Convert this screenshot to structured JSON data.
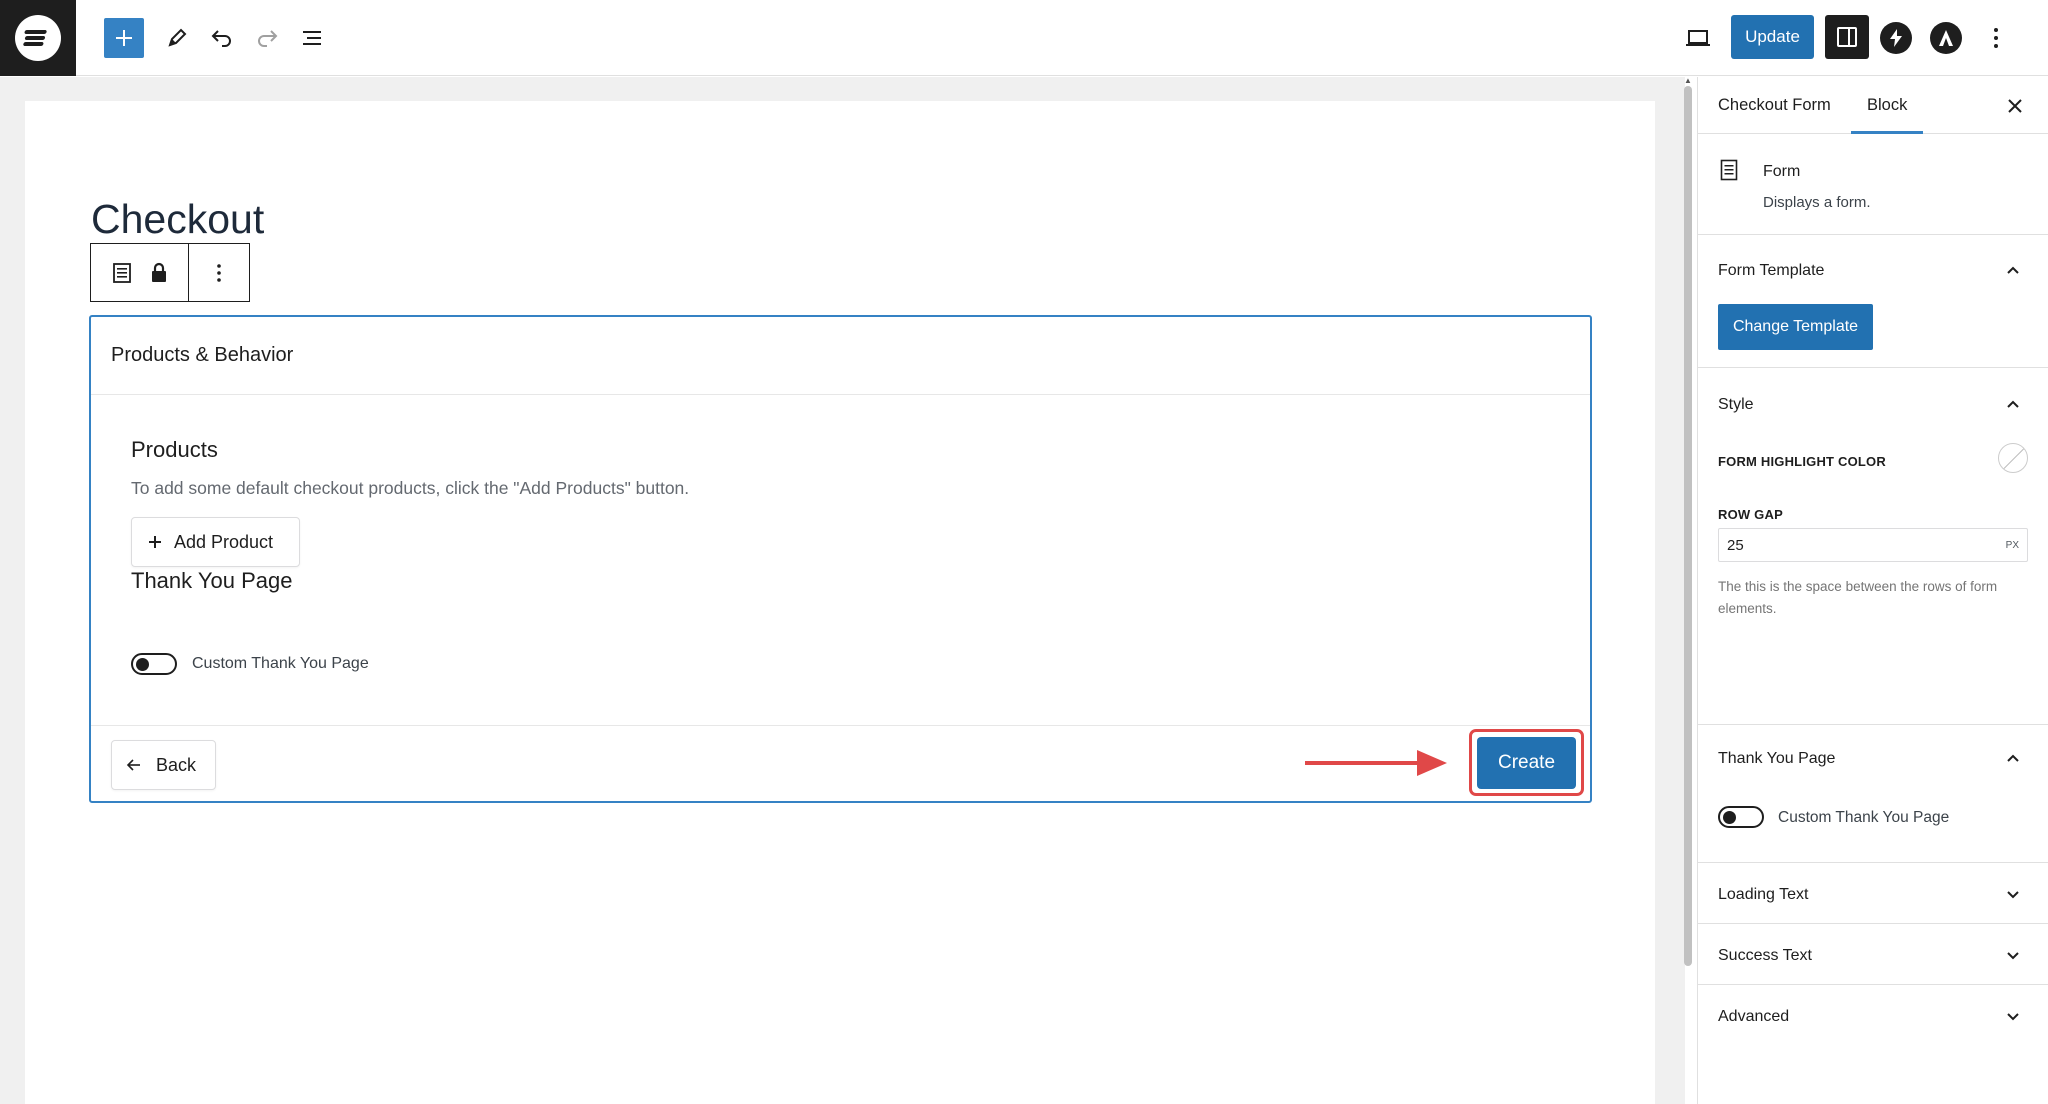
{
  "toolbar": {
    "add_icon": "plus-icon",
    "tools_icon": "pencil-icon",
    "undo_icon": "undo-icon",
    "redo_icon": "redo-icon",
    "outline_icon": "list-view-icon",
    "preview_icon": "desktop-icon",
    "update_label": "Update",
    "settings_icon": "sidebar-toggle-icon",
    "more_icon": "vertical-dots-icon"
  },
  "editor": {
    "page_title": "Checkout",
    "card": {
      "header": "Products & Behavior",
      "products_title": "Products",
      "products_hint": "To add some default checkout products, click the \"Add Products\" button.",
      "add_product_label": "Add Product",
      "thank_you_title": "Thank You Page",
      "thank_you_toggle_label": "Custom Thank You Page",
      "back_label": "Back",
      "create_label": "Create"
    }
  },
  "sidebar": {
    "tabs": [
      "Checkout Form",
      "Block"
    ],
    "active_tab": "Block",
    "block": {
      "name": "Form",
      "description": "Displays a form."
    },
    "form_template": {
      "heading": "Form Template",
      "button_label": "Change Template"
    },
    "style": {
      "heading": "Style",
      "highlight_label": "FORM HIGHLIGHT COLOR",
      "row_gap_label": "ROW GAP",
      "row_gap_value": "25",
      "row_gap_unit": "PX",
      "help": "The this is the space between the rows of form elements."
    },
    "thank_you": {
      "heading": "Thank You Page",
      "toggle_label": "Custom Thank You Page"
    },
    "loading_text": "Loading Text",
    "success_text": "Success Text",
    "advanced": "Advanced"
  },
  "colors": {
    "accent": "#2271b1",
    "highlight": "#e04848",
    "selection_border": "#3582c4"
  }
}
